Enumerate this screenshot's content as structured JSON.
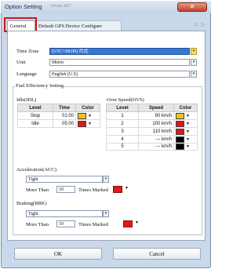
{
  "window": {
    "title": "Option Setting",
    "title_blur": "Vehicle   EET",
    "close_label": "✕"
  },
  "tabs": [
    {
      "label": "General",
      "active": true
    },
    {
      "label": "Default GPS Device Configure",
      "active": false
    }
  ],
  "tab_scroll_arrows": "◁ ▷",
  "general": {
    "time_zone": {
      "label": "Time Zone",
      "value": "(UTC+08:00) 台北"
    },
    "unit": {
      "label": "Unit",
      "value": "Metric"
    },
    "language": {
      "label": "Language",
      "value": "English (U.S)"
    }
  },
  "fuel": {
    "group_title": "Fuel Effeciency Setting",
    "idle": {
      "title": "Idle(IDL)",
      "columns": [
        "Level",
        "Time",
        "Color"
      ],
      "rows": [
        {
          "level": "Stop",
          "time": "01:00",
          "color": "#f2c21a"
        },
        {
          "level": "Idle",
          "time": "05:00",
          "color": "#e01818"
        }
      ]
    },
    "overspeed": {
      "title": "Over Speed(OVS)",
      "columns": [
        "Level",
        "Speed",
        "Color"
      ],
      "rows": [
        {
          "level": "1",
          "speed": "90 km/h",
          "color": "#f2c21a"
        },
        {
          "level": "2",
          "speed": "100 km/h",
          "color": "#e01818"
        },
        {
          "level": "3",
          "speed": "110 km/h",
          "color": "#e01818"
        },
        {
          "level": "4",
          "speed": "--- km/h",
          "color": "#000000"
        },
        {
          "level": "5",
          "speed": "--- km/h",
          "color": "#000000"
        }
      ]
    },
    "acceleration": {
      "title": "Acceleration(ACC)",
      "mode": "Tight",
      "more_than_label": "More Than",
      "count": "10",
      "times_marked_label": "Times Marked",
      "color": "#e01818"
    },
    "braking": {
      "title": "Braking(BRK)",
      "mode": "Tight",
      "more_than_label": "More Than",
      "count": "10",
      "times_marked_label": "Times Marked",
      "color": "#e01818"
    }
  },
  "buttons": {
    "ok": "OK",
    "cancel": "Cancel"
  }
}
